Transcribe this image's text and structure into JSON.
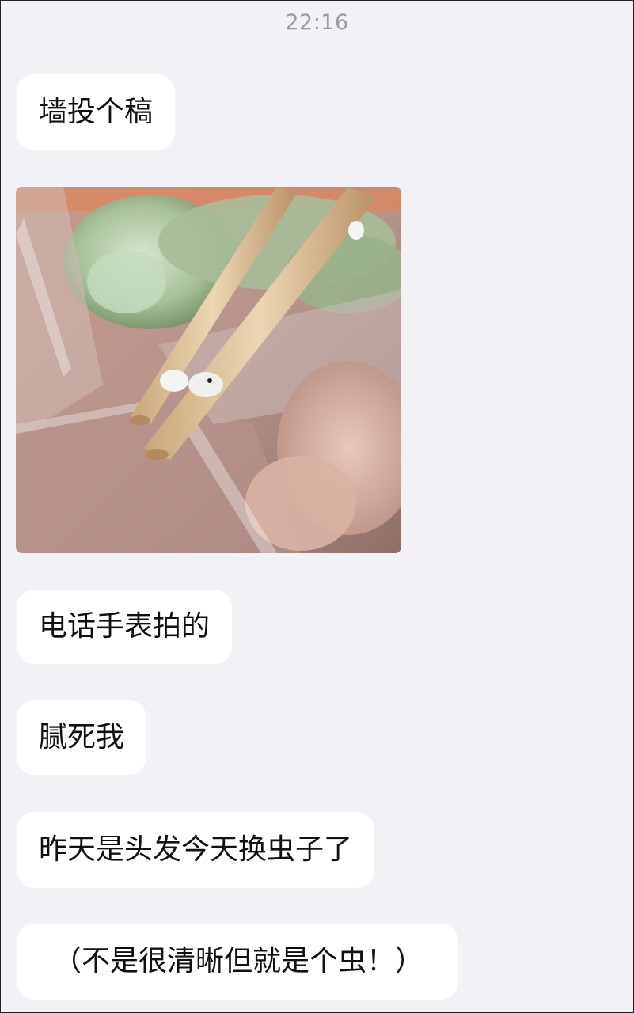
{
  "status": {
    "time": "22:16"
  },
  "chat": {
    "messages": [
      {
        "type": "text",
        "text": "墙投个稿"
      },
      {
        "type": "image",
        "icon": "photo-chopsticks-food-container"
      },
      {
        "type": "text",
        "text": "电话手表拍的"
      },
      {
        "type": "text",
        "text": "腻死我"
      },
      {
        "type": "text",
        "text": "昨天是头发今天换虫子了"
      },
      {
        "type": "text",
        "text": "（不是很清晰但就是个虫！）"
      }
    ]
  },
  "colors": {
    "background": "#f2f1f6",
    "bubble": "#ffffff",
    "text": "#111111",
    "timestamp": "#9a9a9f"
  }
}
